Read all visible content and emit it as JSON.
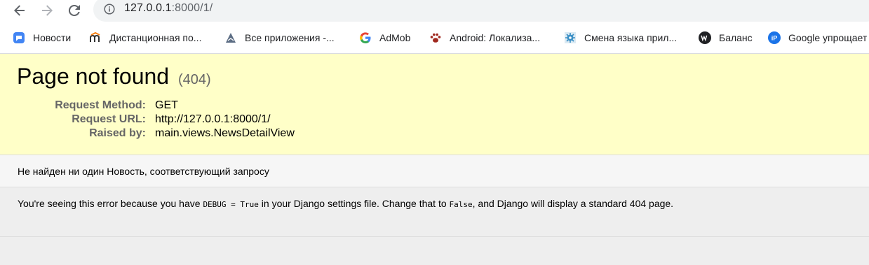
{
  "browser": {
    "url_host": "127.0.0.1",
    "url_rest": ":8000/1/"
  },
  "bookmarks": [
    {
      "label": "Новости",
      "icon": "chat-bubble-icon"
    },
    {
      "label": "Дистанционная по...",
      "icon": "moodle-icon"
    },
    {
      "label": "Все приложения -...",
      "icon": "play-console-icon"
    },
    {
      "label": "AdMob",
      "icon": "google-g-icon"
    },
    {
      "label": "Android: Локализа...",
      "icon": "paw-icon"
    },
    {
      "label": "Смена языка прил...",
      "icon": "gear-badge-icon"
    },
    {
      "label": "Баланс",
      "icon": "w-circle-icon"
    },
    {
      "label": "Google упрощает",
      "icon": "ip-circle-icon"
    }
  ],
  "summary": {
    "title": "Page not found",
    "code": "(404)",
    "rows": [
      {
        "label": "Request Method:",
        "value": "GET"
      },
      {
        "label": "Request URL:",
        "value": "http://127.0.0.1:8000/1/"
      },
      {
        "label": "Raised by:",
        "value": "main.views.NewsDetailView"
      }
    ]
  },
  "info": {
    "message": "Не найден ни один Новость, соответствующий запросу"
  },
  "explanation": {
    "part1": "You're seeing this error because you have ",
    "code1": "DEBUG = True",
    "part2": " in your Django settings file. Change that to ",
    "code2": "False",
    "part3": ", and Django will display a standard 404 page."
  },
  "colors": {
    "summary_bg": "#ffffc8",
    "info_bg": "#f6f6f6",
    "explanation_bg": "#eeeeee"
  }
}
